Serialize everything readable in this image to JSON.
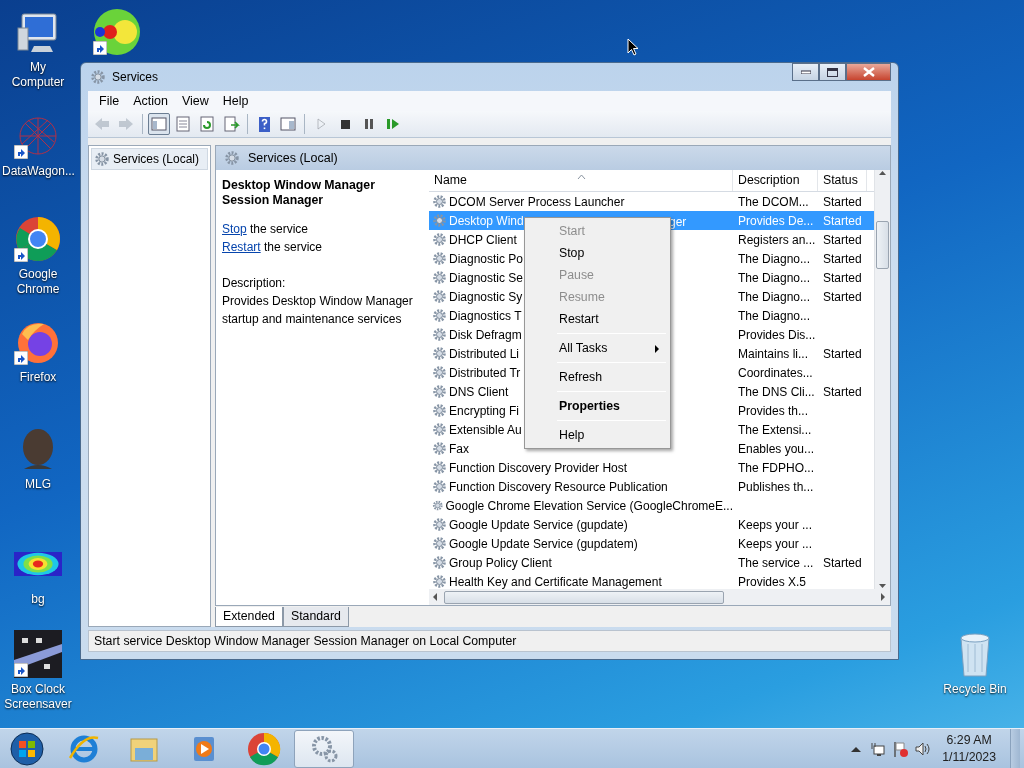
{
  "desktop_icons": [
    {
      "label": "My Computer",
      "kind": "computer",
      "shortcut": false
    },
    {
      "kind": "circles",
      "shortcut": true
    },
    {
      "label": "DataWagon...",
      "kind": "network",
      "shortcut": true
    },
    {
      "label": "Google Chrome",
      "kind": "chrome",
      "shortcut": true
    },
    {
      "label": "Firefox",
      "kind": "firefox",
      "shortcut": true
    },
    {
      "label": "MLG",
      "kind": "person",
      "shortcut": false
    },
    {
      "label": "bg",
      "kind": "heatmap",
      "shortcut": false
    },
    {
      "label": "Box Clock Screensaver",
      "kind": "screensaver",
      "shortcut": true
    },
    {
      "label": "Recycle Bin",
      "kind": "recycle",
      "shortcut": false
    }
  ],
  "window": {
    "title": "Services",
    "menu": [
      "File",
      "Action",
      "View",
      "Help"
    ],
    "toolbar": [
      {
        "kind": "back",
        "disabled": true,
        "pressed": false
      },
      {
        "kind": "forward",
        "disabled": true,
        "pressed": false
      },
      {
        "kind": "separator"
      },
      {
        "kind": "tree",
        "disabled": false,
        "pressed": true
      },
      {
        "kind": "properties",
        "disabled": false,
        "pressed": false
      },
      {
        "kind": "refresh",
        "disabled": false,
        "pressed": false
      },
      {
        "kind": "export",
        "disabled": false,
        "pressed": false
      },
      {
        "kind": "separator"
      },
      {
        "kind": "help",
        "disabled": false,
        "pressed": false
      },
      {
        "kind": "pane",
        "disabled": false,
        "pressed": false
      },
      {
        "kind": "separator"
      },
      {
        "kind": "play",
        "disabled": true,
        "pressed": false
      },
      {
        "kind": "stop",
        "disabled": false,
        "pressed": false
      },
      {
        "kind": "pause",
        "disabled": false,
        "pressed": false
      },
      {
        "kind": "resume",
        "disabled": false,
        "pressed": false
      }
    ],
    "tree": [
      {
        "label": "Services (Local)",
        "selected": true
      }
    ],
    "pane_title": "Services (Local)",
    "details": {
      "title": "Desktop Window Manager Session Manager",
      "actions": [
        {
          "link": "Stop",
          "text": " the service"
        },
        {
          "link": "Restart",
          "text": " the service"
        }
      ],
      "description_label": "Description:",
      "description": "Provides Desktop Window Manager startup and maintenance services"
    },
    "table": {
      "columns": [
        "Name",
        "Description",
        "Status"
      ],
      "rows": [
        {
          "name": "DCOM Server Process Launcher",
          "description": "The DCOM...",
          "status": "Started",
          "selected": false
        },
        {
          "name": "Desktop Wind",
          "name_tail": "ger",
          "description": "Provides De...",
          "status": "Started",
          "selected": true
        },
        {
          "name": "DHCP Client",
          "description": "Registers an...",
          "status": "Started",
          "selected": false
        },
        {
          "name": "Diagnostic Po",
          "description": "The Diagno...",
          "status": "Started",
          "selected": false
        },
        {
          "name": "Diagnostic Se",
          "description": "The Diagno...",
          "status": "Started",
          "selected": false
        },
        {
          "name": "Diagnostic Sy",
          "description": "The Diagno...",
          "status": "Started",
          "selected": false
        },
        {
          "name": "Diagnostics T",
          "description": "The Diagno...",
          "selected": false
        },
        {
          "name": "Disk Defragm",
          "description": "Provides Dis...",
          "selected": false
        },
        {
          "name": "Distributed Li",
          "description": "Maintains li...",
          "status": "Started",
          "selected": false
        },
        {
          "name": "Distributed Tr",
          "description": "Coordinates...",
          "selected": false
        },
        {
          "name": "DNS Client",
          "description": "The DNS Cli...",
          "status": "Started",
          "selected": false
        },
        {
          "name": "Encrypting Fi",
          "description": "Provides th...",
          "selected": false
        },
        {
          "name": "Extensible Au",
          "description": "The Extensi...",
          "selected": false
        },
        {
          "name": "Fax",
          "description": "Enables you...",
          "selected": false
        },
        {
          "name": "Function Discovery Provider Host",
          "description": "The FDPHO...",
          "selected": false
        },
        {
          "name": "Function Discovery Resource Publication",
          "description": "Publishes th...",
          "selected": false
        },
        {
          "name": "Google Chrome Elevation Service (GoogleChromeE...",
          "selected": false
        },
        {
          "name": "Google Update Service (gupdate)",
          "description": "Keeps your ...",
          "selected": false
        },
        {
          "name": "Google Update Service (gupdatem)",
          "description": "Keeps your ...",
          "selected": false
        },
        {
          "name": "Group Policy Client",
          "description": "The service ...",
          "status": "Started",
          "selected": false
        },
        {
          "name": "Health Key and Certificate Management",
          "description": "Provides X.5",
          "selected": false
        }
      ]
    },
    "view_tabs": [
      {
        "label": "Extended",
        "selected": true
      },
      {
        "label": "Standard",
        "selected": false
      }
    ],
    "status_bar": "Start service Desktop Window Manager Session Manager on Local Computer"
  },
  "context_menu": [
    {
      "kind": "item",
      "label": "Start",
      "disabled": true,
      "default": false,
      "submenu": false
    },
    {
      "kind": "item",
      "label": "Stop",
      "disabled": false,
      "default": false,
      "submenu": false
    },
    {
      "kind": "item",
      "label": "Pause",
      "disabled": true,
      "default": false,
      "submenu": false
    },
    {
      "kind": "item",
      "label": "Resume",
      "disabled": true,
      "default": false,
      "submenu": false
    },
    {
      "kind": "item",
      "label": "Restart",
      "disabled": false,
      "default": false,
      "submenu": false
    },
    {
      "kind": "separator"
    },
    {
      "kind": "item",
      "label": "All Tasks",
      "disabled": false,
      "default": false,
      "submenu": true
    },
    {
      "kind": "separator"
    },
    {
      "kind": "item",
      "label": "Refresh",
      "disabled": false,
      "default": false,
      "submenu": false
    },
    {
      "kind": "separator"
    },
    {
      "kind": "item",
      "label": "Properties",
      "disabled": false,
      "default": true,
      "submenu": false
    },
    {
      "kind": "separator"
    },
    {
      "kind": "item",
      "label": "Help",
      "disabled": false,
      "default": false,
      "submenu": false
    }
  ],
  "taskbar": {
    "buttons": [
      {
        "kind": "start",
        "selected": false
      },
      {
        "kind": "ie",
        "selected": false
      },
      {
        "kind": "explorer",
        "selected": false
      },
      {
        "kind": "media",
        "selected": false
      },
      {
        "kind": "chrome",
        "selected": false
      },
      {
        "kind": "services",
        "selected": true
      }
    ],
    "tray": [
      {
        "kind": "up"
      },
      {
        "kind": "network"
      },
      {
        "kind": "flag"
      },
      {
        "kind": "volume"
      }
    ],
    "time": "6:29 AM",
    "date": "1/11/2023"
  }
}
